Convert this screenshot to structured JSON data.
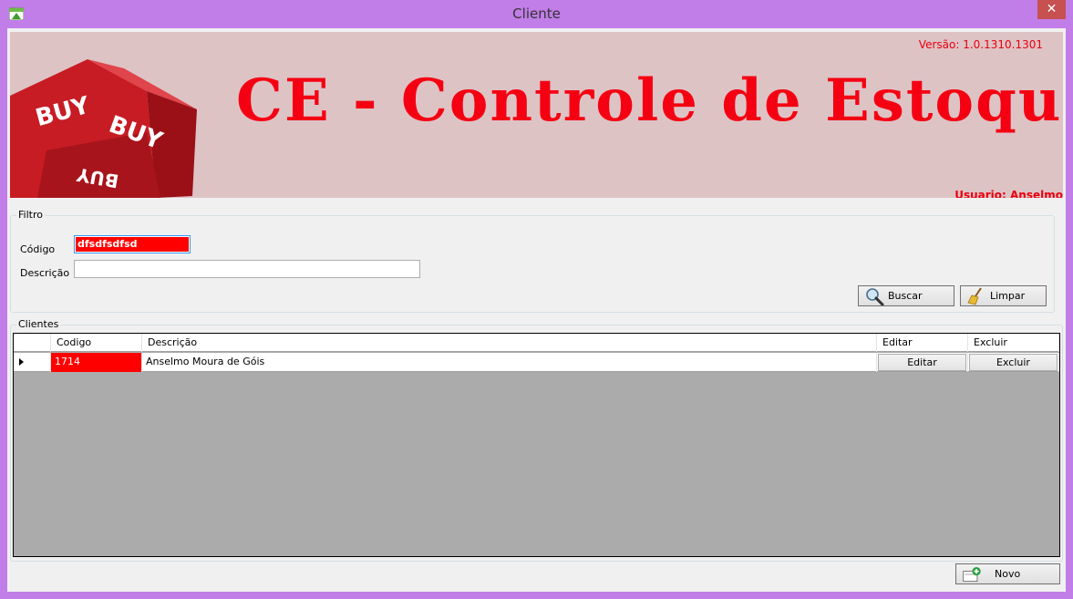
{
  "window": {
    "title": "Cliente",
    "close_glyph": "✕"
  },
  "banner": {
    "version": "Versão: 1.0.1310.1301",
    "title": "CE - Controle de Estoque",
    "user": "Usuario: Anselmo",
    "logo_text": [
      "BUY",
      "BUY",
      "BUY"
    ],
    "title_color": "#f50012"
  },
  "filter": {
    "group_title": "Filtro",
    "codigo_label": "Código",
    "codigo_value": "dfsdfsdfsd",
    "descricao_label": "Descrição",
    "descricao_value": "",
    "buscar_label": "Buscar",
    "buscar_icon": "magnifier-icon",
    "limpar_label": "Limpar",
    "limpar_icon": "broom-icon"
  },
  "clients": {
    "group_title": "Clientes",
    "columns": [
      "Codigo",
      "Descrição",
      "Editar",
      "Excluir"
    ],
    "rows": [
      {
        "codigo": "1714",
        "descricao": "Anselmo Moura de Góis",
        "editar": "Editar",
        "excluir": "Excluir"
      }
    ],
    "selected_color": "#ff0000",
    "empty_area_color": "#ababab"
  },
  "footer": {
    "novo_label": "Novo",
    "novo_icon": "new-document-icon"
  }
}
